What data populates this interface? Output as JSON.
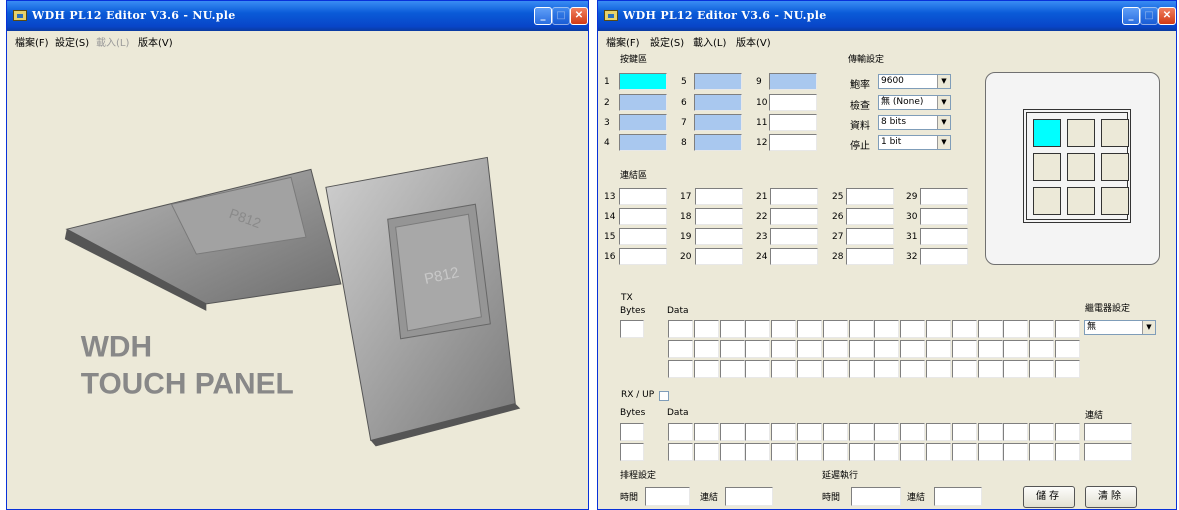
{
  "window1": {
    "title": "WDH PL12 Editor V3.6 - NU.ple",
    "menu": [
      "檔案(F)",
      "設定(S)",
      "載入(L)",
      "版本(V)"
    ],
    "splash": {
      "line1": "WDH",
      "line2": "TOUCH PANEL",
      "panel_text": "P812"
    }
  },
  "window2": {
    "title": "WDH PL12 Editor V3.6 - NU.ple",
    "menu": [
      "檔案(F)",
      "設定(S)",
      "載入(L)",
      "版本(V)"
    ],
    "keys": {
      "title": "按鍵區",
      "labels": [
        "1",
        "2",
        "3",
        "4",
        "5",
        "6",
        "7",
        "8",
        "9",
        "10",
        "11",
        "12"
      ],
      "colors": {
        "cyan": "#00ffff",
        "blue": "#a9c8ef"
      }
    },
    "link": {
      "title": "連結區",
      "labels": [
        "13",
        "14",
        "15",
        "16",
        "17",
        "18",
        "19",
        "20",
        "21",
        "22",
        "23",
        "24",
        "25",
        "26",
        "27",
        "28",
        "29",
        "30",
        "31",
        "32"
      ]
    },
    "comm": {
      "title": "傳輸設定",
      "fields": [
        {
          "label": "鮑率",
          "value": "9600"
        },
        {
          "label": "檢查",
          "value": "無 (None)"
        },
        {
          "label": "資料",
          "value": "8 bits"
        },
        {
          "label": "停止",
          "value": "1 bit"
        }
      ]
    },
    "tx": {
      "title": "TX",
      "bytes": "Bytes",
      "data": "Data"
    },
    "relay": {
      "title": "繼電器設定",
      "value": "無"
    },
    "rx": {
      "title": "RX / UP",
      "bytes": "Bytes",
      "data": "Data",
      "link": "連結"
    },
    "schedule": {
      "title": "排程設定",
      "time": "時間",
      "link": "連結"
    },
    "delay": {
      "title": "延遲執行",
      "time": "時間",
      "link": "連結"
    },
    "buttons": {
      "save": "儲存",
      "clear": "清除"
    }
  }
}
